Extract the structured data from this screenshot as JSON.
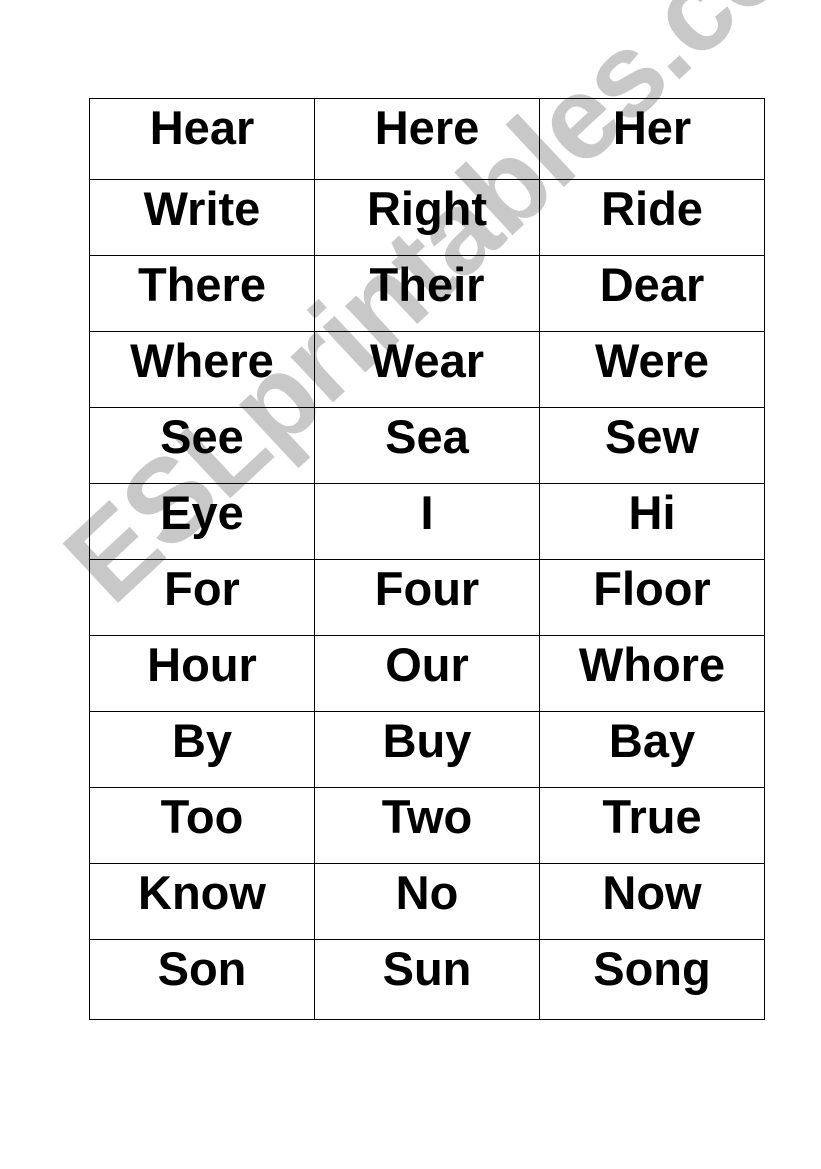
{
  "watermark": "ESLprintables.com",
  "colors": {
    "watermark": "#c8c8c8",
    "text": "#000000",
    "border": "#000000"
  },
  "rows": [
    [
      "Hear",
      "Here",
      "Her"
    ],
    [
      "Write",
      "Right",
      "Ride"
    ],
    [
      "There",
      "Their",
      "Dear"
    ],
    [
      "Where",
      "Wear",
      "Were"
    ],
    [
      "See",
      "Sea",
      "Sew"
    ],
    [
      "Eye",
      "I",
      "Hi"
    ],
    [
      "For",
      "Four",
      "Floor"
    ],
    [
      "Hour",
      "Our",
      "Whore"
    ],
    [
      "By",
      "Buy",
      "Bay"
    ],
    [
      "Too",
      "Two",
      "True"
    ],
    [
      "Know",
      "No",
      "Now"
    ],
    [
      "Son",
      "Sun",
      "Song"
    ]
  ]
}
